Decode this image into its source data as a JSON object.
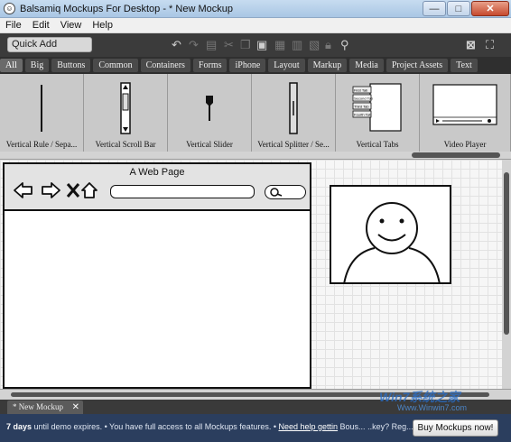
{
  "window": {
    "title": "Balsamiq Mockups For Desktop - * New Mockup",
    "minimize": "—",
    "maximize": "□",
    "close": "✕"
  },
  "menu": [
    "File",
    "Edit",
    "View",
    "Help"
  ],
  "toolbar": {
    "quick_add": "Quick Add",
    "icons": [
      "undo-icon",
      "redo-icon",
      "duplicate-icon",
      "cut-icon",
      "copy-icon",
      "paste-icon",
      "group-icon",
      "ungroup-icon",
      "lock-icon",
      "search-icon"
    ],
    "right_icons": [
      "close-mockup-icon",
      "fullscreen-icon"
    ]
  },
  "category_tabs": [
    "All",
    "Big",
    "Buttons",
    "Common",
    "Containers",
    "Forms",
    "iPhone",
    "Layout",
    "Markup",
    "Media",
    "Project Assets",
    "Text"
  ],
  "active_category": "All",
  "components": [
    {
      "label": "Vertical Rule / Sepa...",
      "icon": "vertical-rule-icon"
    },
    {
      "label": "Vertical Scroll Bar",
      "icon": "vertical-scrollbar-icon"
    },
    {
      "label": "Vertical Slider",
      "icon": "vertical-slider-icon"
    },
    {
      "label": "Vertical Splitter / Se...",
      "icon": "vertical-splitter-icon"
    },
    {
      "label": "Vertical Tabs",
      "icon": "vertical-tabs-icon",
      "tab_labels": [
        "First Tab",
        "Second Tab",
        "Third Tab",
        "Fourth Tab"
      ]
    },
    {
      "label": "Video Player",
      "icon": "video-player-icon"
    }
  ],
  "canvas": {
    "browser_title": "A Web Page"
  },
  "doc_tab": {
    "label": "* New Mockup",
    "close": "✕"
  },
  "status": {
    "days": "7 days",
    "message": " until demo expires. • You have full access to all Mockups features. • ",
    "link": "Need help gettin",
    "trailing": "  Bous... ..key? Reg... ",
    "buy_button": "Buy Mockups now!"
  },
  "watermark": {
    "main": "Win7系统之家",
    "sub": "Www.Winwin7.com"
  },
  "colors": {
    "toolbar": "#3b3b3b",
    "status_bar": "#2b3e5e",
    "canvas_grid": "#e2e2e2"
  }
}
